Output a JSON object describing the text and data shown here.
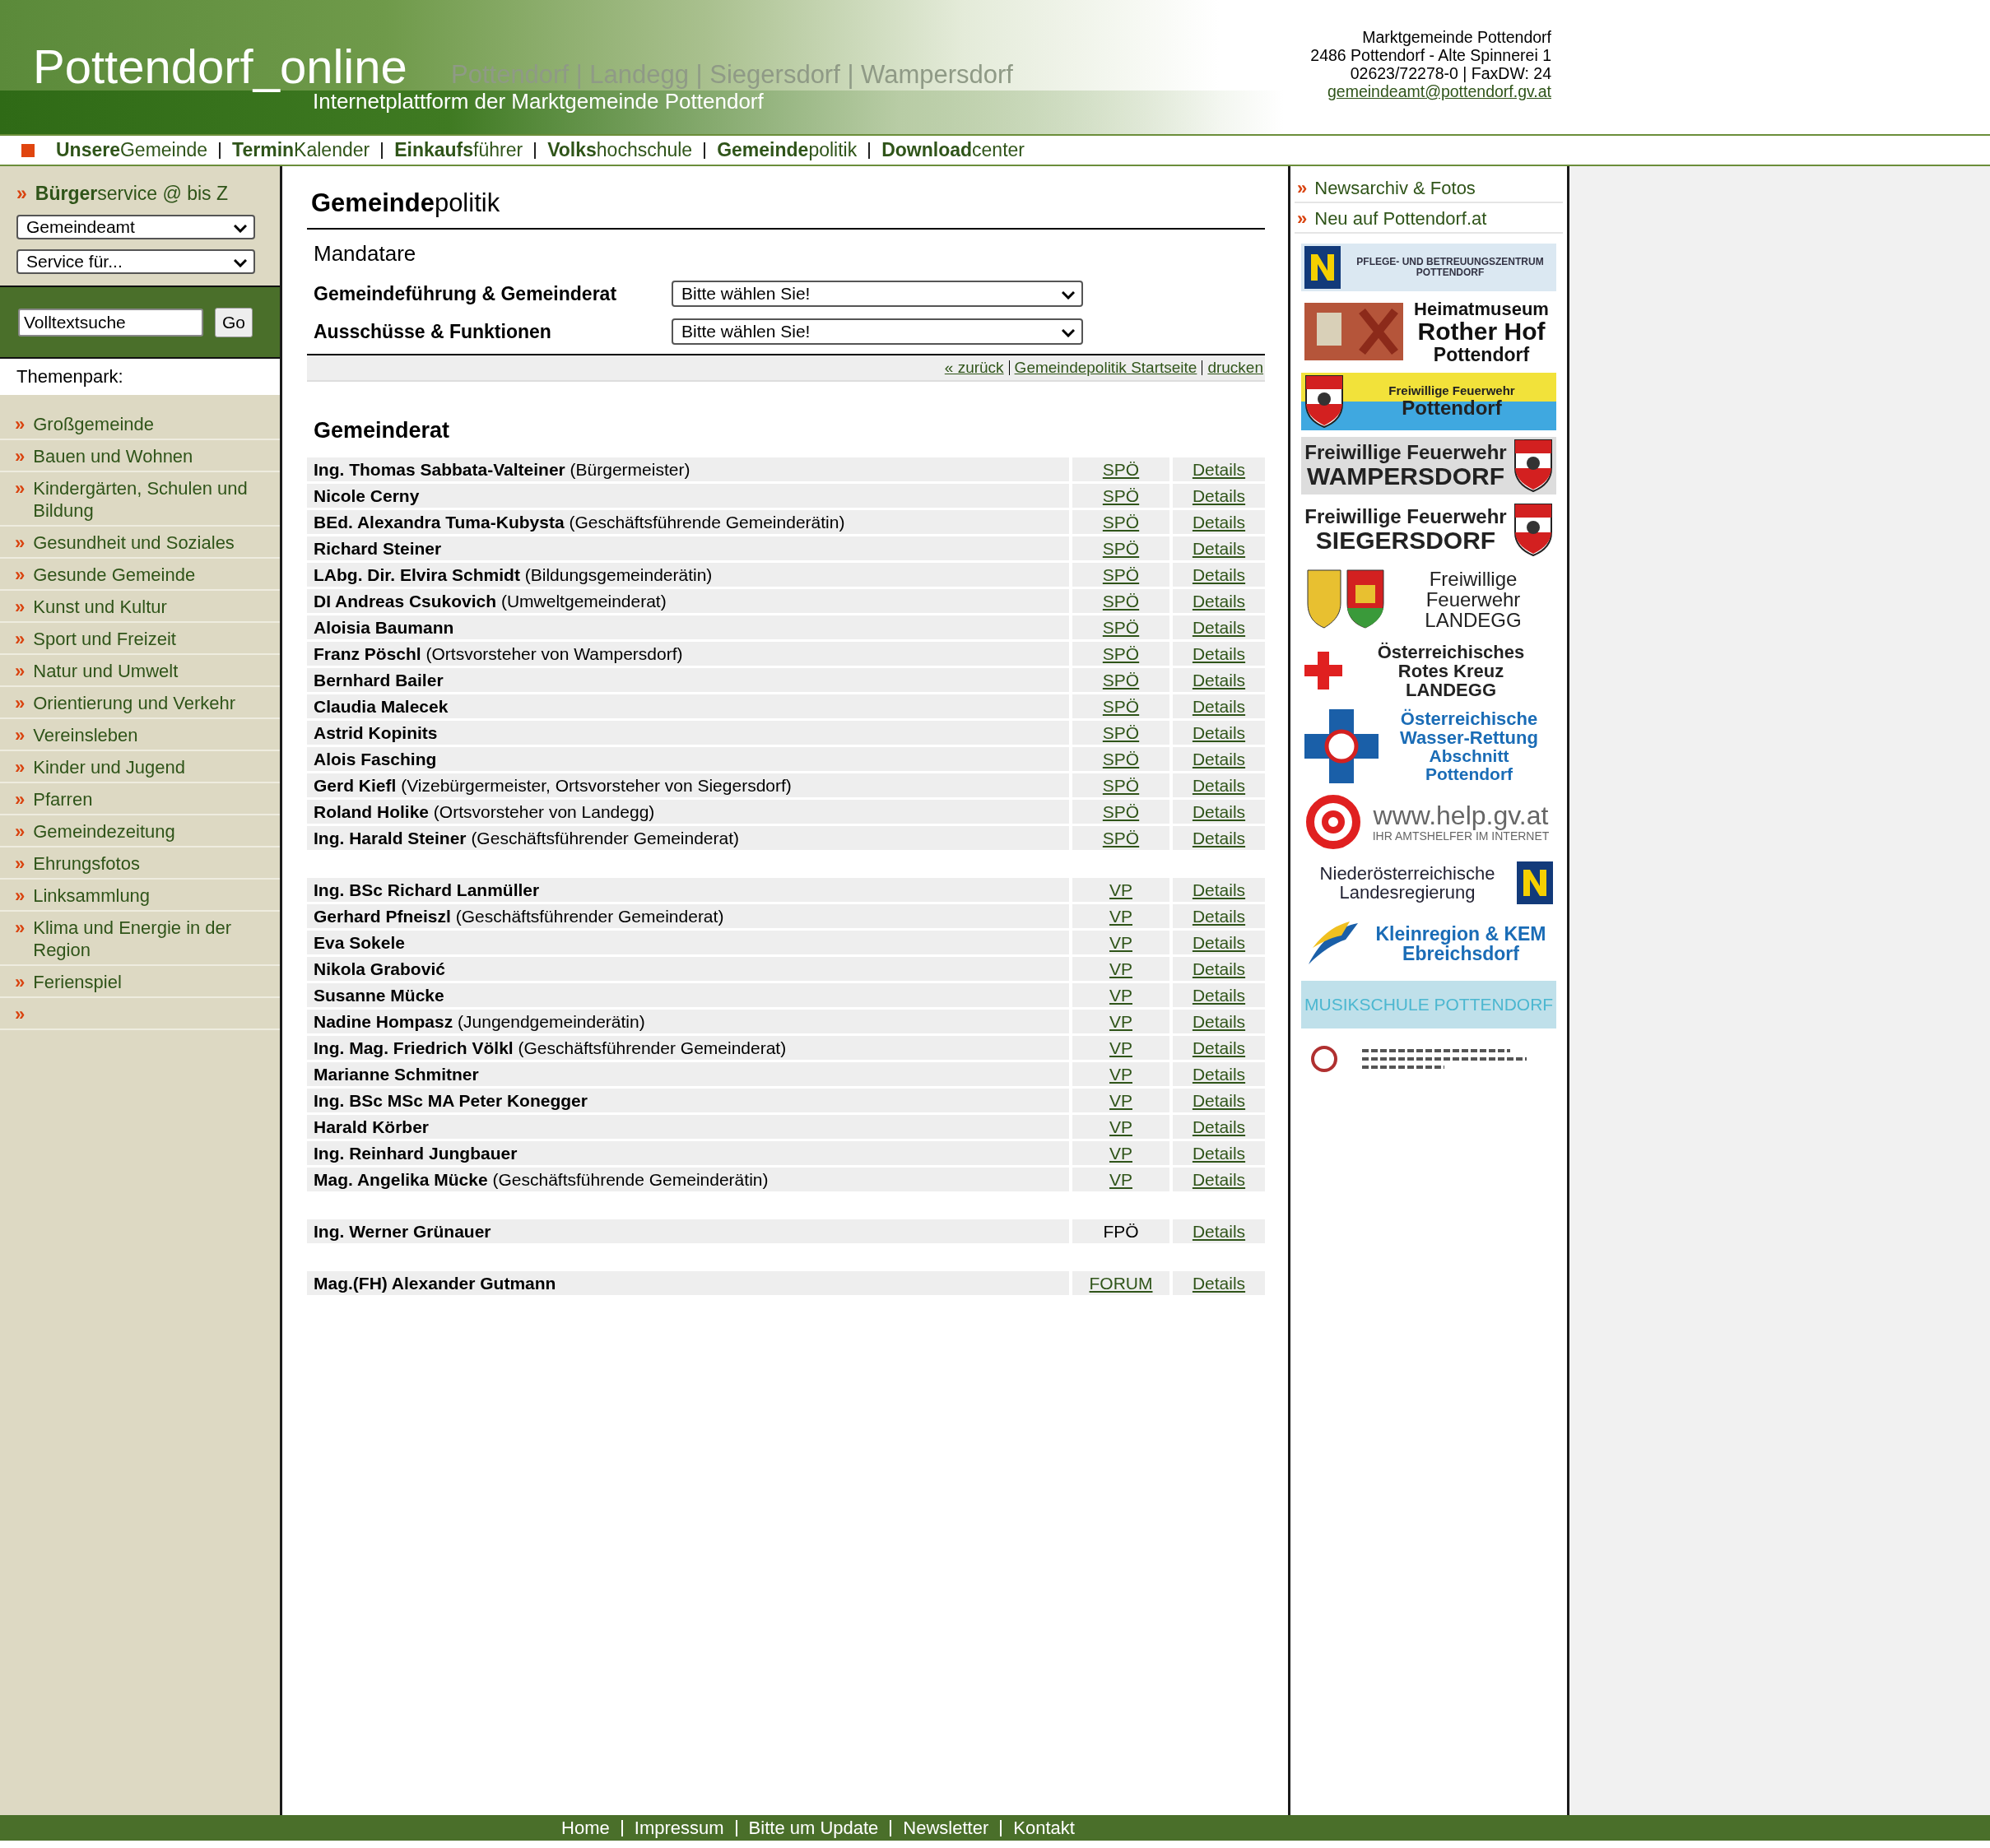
{
  "header": {
    "site_title": "Pottendorf_online",
    "localities": "Pottendorf | Landegg | Siegersdorf | Wampersdorf",
    "tagline": "Internetplattform der Marktgemeinde Pottendorf",
    "contact": [
      "Marktgemeinde Pottendorf",
      "2486 Pottendorf - Alte Spinnerei 1",
      "02623/72278-0 | FaxDW: 24"
    ],
    "email": "gemeindeamt@pottendorf.gv.at"
  },
  "nav": [
    "**Unsere**Gemeinde",
    "**Termin**Kalender",
    "**Einkaufs**führer",
    "**Volks**hochschule",
    "**Gemeinde**politik",
    "**Download**center"
  ],
  "sidebar": {
    "service_title": "**Bürger**service @ bis Z",
    "service_bullet": "»",
    "service_selects": [
      "Gemeindeamt",
      "Service für..."
    ],
    "search": {
      "value": "Volltextsuche",
      "button": "Go"
    },
    "themenpark_label": "Themenpark:",
    "items": [
      {
        "bullet": "»",
        "label": "Großgemeinde"
      },
      {
        "bullet": "»",
        "label": "Bauen und Wohnen"
      },
      {
        "bullet": "»",
        "label": "Kindergärten, Schulen und Bildung"
      },
      {
        "bullet": "»",
        "label": "Gesundheit und Soziales"
      },
      {
        "bullet": "»",
        "label": "Gesunde Gemeinde"
      },
      {
        "bullet": "»",
        "label": "Kunst und Kultur"
      },
      {
        "bullet": "»",
        "label": "Sport und Freizeit"
      },
      {
        "bullet": "»",
        "label": "Natur und Umwelt"
      },
      {
        "bullet": "»",
        "label": "Orientierung und Verkehr"
      },
      {
        "bullet": "»",
        "label": "Vereinsleben"
      },
      {
        "bullet": "»",
        "label": "Kinder und Jugend"
      },
      {
        "bullet": "»",
        "label": "Pfarren"
      },
      {
        "bullet": "»",
        "label": "Gemeindezeitung"
      },
      {
        "bullet": "»",
        "label": "Ehrungsfotos"
      },
      {
        "bullet": "»",
        "label": "Linksammlung"
      },
      {
        "bullet": "»",
        "label": "Klima und Energie in der Region"
      },
      {
        "bullet": "»",
        "label": "Ferienspiel"
      },
      {
        "bullet": "»"
      }
    ]
  },
  "main": {
    "title": "**Gemeinde**politik",
    "section": "Mandatare",
    "filters": [
      {
        "label": "Gemeindeführung & Gemeinderat",
        "value": "Bitte wählen Sie!"
      },
      {
        "label": "Ausschüsse & Funktionen",
        "value": "Bitte wählen Sie!"
      }
    ],
    "actions": [
      "« zurück",
      "Gemeindepolitik Startseite",
      "drucken"
    ],
    "council": {
      "title": "Gemeinderat",
      "groups": [
        {
          "party_linked": true,
          "members": [
            {
              "name": "Ing. Thomas Sabbata-Valteiner",
              "role": "(Bürgermeister)",
              "party": "SPÖ",
              "details": "Details"
            },
            {
              "name": "Nicole Cerny",
              "party": "SPÖ",
              "details": "Details"
            },
            {
              "name": "BEd. Alexandra Tuma-Kubysta",
              "role": "(Geschäftsführende Gemeinderätin)",
              "party": "SPÖ",
              "details": "Details"
            },
            {
              "name": "Richard Steiner",
              "party": "SPÖ",
              "details": "Details"
            },
            {
              "name": "LAbg. Dir. Elvira Schmidt",
              "role": "(Bildungsgemeinderätin)",
              "party": "SPÖ",
              "details": "Details"
            },
            {
              "name": "DI Andreas Csukovich",
              "role": "(Umweltgemeinderat)",
              "party": "SPÖ",
              "details": "Details"
            },
            {
              "name": "Aloisia Baumann",
              "party": "SPÖ",
              "details": "Details"
            },
            {
              "name": "Franz Pöschl",
              "role": "(Ortsvorsteher von Wampersdorf)",
              "party": "SPÖ",
              "details": "Details"
            },
            {
              "name": "Bernhard Bailer",
              "party": "SPÖ",
              "details": "Details"
            },
            {
              "name": "Claudia Malecek",
              "party": "SPÖ",
              "details": "Details"
            },
            {
              "name": "Astrid Kopinits",
              "party": "SPÖ",
              "details": "Details"
            },
            {
              "name": "Alois Fasching",
              "party": "SPÖ",
              "details": "Details"
            },
            {
              "name": "Gerd Kiefl",
              "role": "(Vizebürgermeister, Ortsvorsteher von Siegersdorf)",
              "party": "SPÖ",
              "details": "Details"
            },
            {
              "name": "Roland Holike",
              "role": "(Ortsvorsteher von Landegg)",
              "party": "SPÖ",
              "details": "Details"
            },
            {
              "name": "Ing. Harald Steiner",
              "role": "(Geschäftsführender Gemeinderat)",
              "party": "SPÖ",
              "details": "Details"
            }
          ]
        },
        {
          "party_linked": true,
          "members": [
            {
              "name": "Ing. BSc Richard Lanmüller",
              "party": "VP",
              "details": "Details"
            },
            {
              "name": "Gerhard Pfneiszl",
              "role": "(Geschäftsführender Gemeinderat)",
              "party": "VP",
              "details": "Details"
            },
            {
              "name": "Eva Sokele",
              "party": "VP",
              "details": "Details"
            },
            {
              "name": "Nikola Grabović",
              "party": "VP",
              "details": "Details"
            },
            {
              "name": "Susanne Mücke",
              "party": "VP",
              "details": "Details"
            },
            {
              "name": "Nadine Hompasz",
              "role": "(Jungendgemeinderätin)",
              "party": "VP",
              "details": "Details"
            },
            {
              "name": "Ing. Mag. Friedrich Völkl",
              "role": "(Geschäftsführender Gemeinderat)",
              "party": "VP",
              "details": "Details"
            },
            {
              "name": "Marianne Schmitner",
              "party": "VP",
              "details": "Details"
            },
            {
              "name": "Ing. BSc MSc MA Peter Konegger",
              "party": "VP",
              "details": "Details"
            },
            {
              "name": "Harald Körber",
              "party": "VP",
              "details": "Details"
            },
            {
              "name": "Ing. Reinhard Jungbauer",
              "party": "VP",
              "details": "Details"
            },
            {
              "name": "Mag. Angelika Mücke",
              "role": "(Geschäftsführende Gemeinderätin)",
              "party": "VP",
              "details": "Details"
            }
          ]
        },
        {
          "party_linked": false,
          "members": [
            {
              "name": "Ing. Werner Grünauer",
              "party": "FPÖ",
              "details": "Details"
            }
          ]
        },
        {
          "party_linked": true,
          "members": [
            {
              "name": "Mag.(FH) Alexander Gutmann",
              "party": "FORUM",
              "details": "Details"
            }
          ]
        }
      ]
    }
  },
  "right": {
    "links": [
      {
        "bullet": "»",
        "label": "Newsarchiv & Fotos"
      },
      {
        "bullet": "»",
        "label": "Neu auf Pottendorf.at"
      }
    ],
    "banners": [
      {
        "kind": "n-left",
        "lines": [
          "PFLEGE- UND BETREUUNGSZENTRUM",
          "POTTENDORF"
        ]
      },
      {
        "kind": "photo-left",
        "lines": [
          "Heimatmuseum",
          "Rother Hof",
          "Pottendorf"
        ]
      },
      {
        "kind": "fire-yellow",
        "lines": [
          "Freiwillige Feuerwehr",
          "Pottendorf"
        ]
      },
      {
        "kind": "shield-right-grey",
        "lines": [
          "Freiwillige Feuerwehr",
          "WAMPERSDORF"
        ]
      },
      {
        "kind": "shield-right",
        "lines": [
          "Freiwillige Feuerwehr",
          "SIEGERSDORF"
        ]
      },
      {
        "kind": "shields-left",
        "lines": [
          "Freiwillige",
          "Feuerwehr",
          "LANDEGG"
        ]
      },
      {
        "kind": "red-cross",
        "lines": [
          "Österreichisches",
          "Rotes Kreuz",
          "LANDEGG"
        ]
      },
      {
        "kind": "blue-cross",
        "lines": [
          "Österreichische",
          "Wasser-Rettung",
          "Abschnitt",
          "Pottendorf"
        ]
      },
      {
        "kind": "at-sign",
        "lines": [
          "www.help.gv.at",
          "IHR AMTSHELFER IM INTERNET"
        ]
      },
      {
        "kind": "n-right",
        "lines": [
          "Niederösterreichische",
          "Landesregierung"
        ]
      },
      {
        "kind": "swoosh-left",
        "lines": [
          "Kleinregion & KEM",
          "Ebreichsdorf"
        ]
      },
      {
        "kind": "plain-blue",
        "lines": [
          "MUSIKSCHULE POTTENDORF"
        ]
      },
      {
        "kind": "emblem"
      }
    ]
  },
  "footer": [
    "Home",
    "Impressum",
    "Bitte um Update",
    "Newsletter",
    "Kontakt"
  ]
}
